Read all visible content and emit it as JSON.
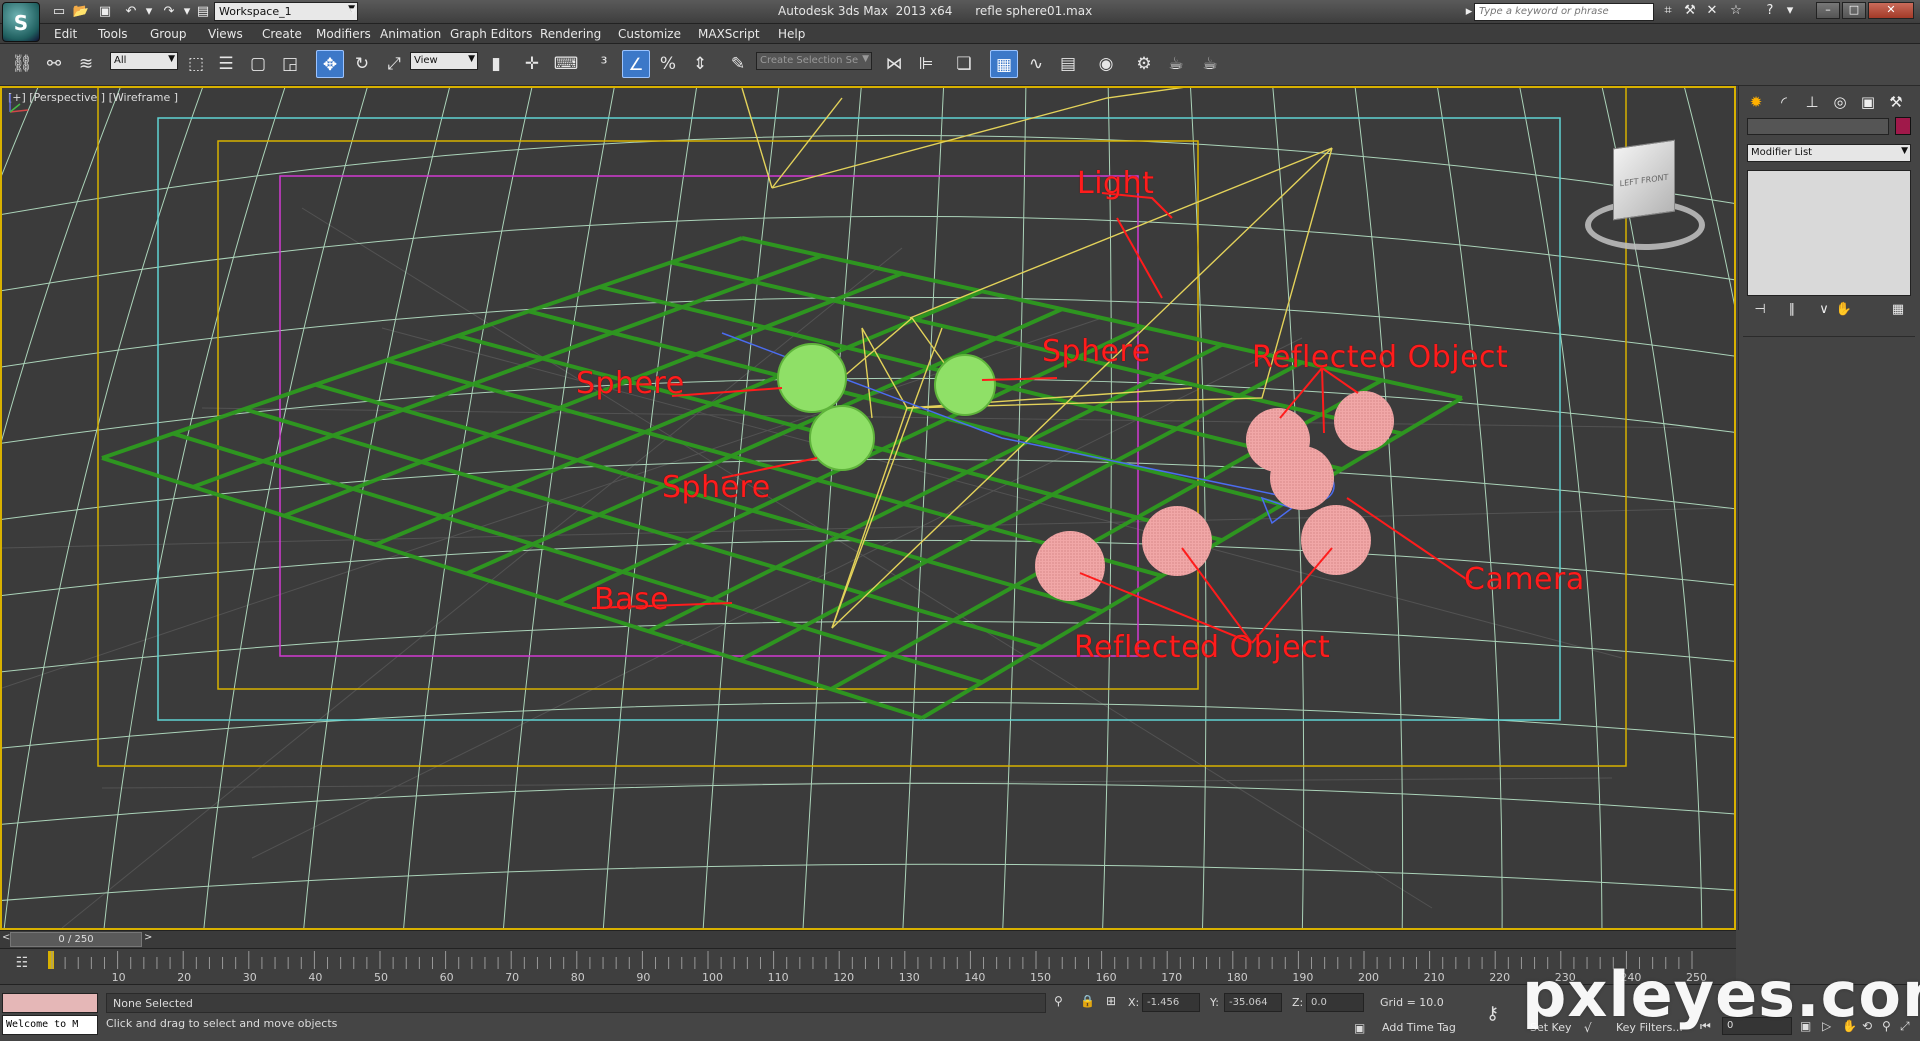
{
  "titlebar": {
    "logo": "S",
    "workspace": "Workspace_1",
    "title": "Autodesk 3ds Max  2013 x64      refle sphere01.max",
    "search_placeholder": "Type a keyword or phrase"
  },
  "menu": [
    "Edit",
    "Tools",
    "Group",
    "Views",
    "Create",
    "Modifiers",
    "Animation",
    "Graph Editors",
    "Rendering",
    "Customize",
    "MAXScript",
    "Help"
  ],
  "toolbar": {
    "filter_value": "All",
    "ref_coord_value": "View",
    "selection_set_placeholder": "Create Selection Se"
  },
  "viewport": {
    "label": "[+] [Perspective ] [Wireframe ]",
    "viewcube_label": "LEFT  FRONT",
    "annotations": {
      "light": "Light",
      "sphere_left": "Sphere",
      "sphere_right": "Sphere",
      "sphere_bottom": "Sphere",
      "reflected_top": "Reflected Object",
      "reflected_bottom": "Reflected Object",
      "camera": "Camera",
      "base": "Base"
    },
    "colors": {
      "grid_line": "#bfeecf",
      "base_grid": "#2e9a1f",
      "sphere": "#8fe067",
      "reflected": "#f1a7a7",
      "light": "#e3d25a",
      "safe_frame_outer": "#5fd3d3",
      "safe_frame_mid": "#d8b100",
      "safe_frame_inner": "#d23ad2",
      "annotation": "#ff1c1c"
    }
  },
  "command_panel": {
    "modifier_list": "Modifier List"
  },
  "timeline": {
    "frame_display": "0 / 250",
    "ticks": [
      "10",
      "20",
      "30",
      "40",
      "50",
      "60",
      "70",
      "80",
      "90",
      "100",
      "110",
      "120",
      "130",
      "140",
      "150",
      "160",
      "170",
      "180",
      "190",
      "200",
      "210",
      "220",
      "230",
      "240",
      "250"
    ]
  },
  "status": {
    "maxscript_text": "Welcome to M",
    "selection": "None Selected",
    "prompt": "Click and drag to select and move objects",
    "x_label": "X:",
    "x_value": "-1.456",
    "y_label": "Y:",
    "y_value": "-35.064",
    "z_label": "Z:",
    "z_value": "0.0",
    "grid": "Grid = 10.0",
    "add_time_tag": "Add Time Tag",
    "set_key": "Set Key",
    "key_filters": "Key Filters...",
    "frame_value": "0"
  },
  "watermark": "pxleyes.com"
}
